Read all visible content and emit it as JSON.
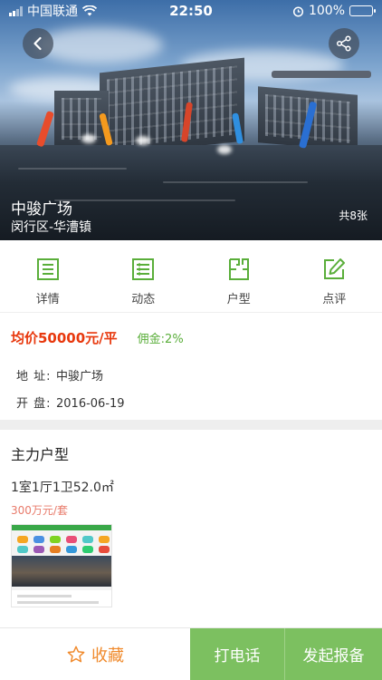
{
  "status_bar": {
    "carrier": "中国联通",
    "time": "22:50",
    "battery": "100%",
    "battery_level": 1.0
  },
  "hero": {
    "title": "中骏广场",
    "subtitle": "闵行区-华漕镇",
    "photo_count": "共8张",
    "back_icon": "back-arrow-icon",
    "share_icon": "share-icon"
  },
  "quick_nav": [
    {
      "label": "详情",
      "icon": "document-list-icon"
    },
    {
      "label": "动态",
      "icon": "news-list-icon"
    },
    {
      "label": "户型",
      "icon": "floor-plan-icon"
    },
    {
      "label": "点评",
      "icon": "edit-icon"
    }
  ],
  "info": {
    "avg_price": "均价50000元/平",
    "commission": "佣金:2%",
    "address_label": "地  址:",
    "address_value": "中骏广场",
    "opening_label": "开  盘:",
    "opening_value": "2016-06-19"
  },
  "main_layouts": {
    "title": "主力户型",
    "items": [
      {
        "name": "1室1厅1卫52.0㎡",
        "price": "300万元/套"
      }
    ]
  },
  "bottom_bar": {
    "favorite_label": "收藏",
    "call_label": "打电话",
    "report_label": "发起报备"
  },
  "colors": {
    "accent_green": "#7cc060",
    "icon_green": "#5aae3a",
    "price_red": "#e8380d",
    "favorite_orange": "#f08a2c"
  }
}
